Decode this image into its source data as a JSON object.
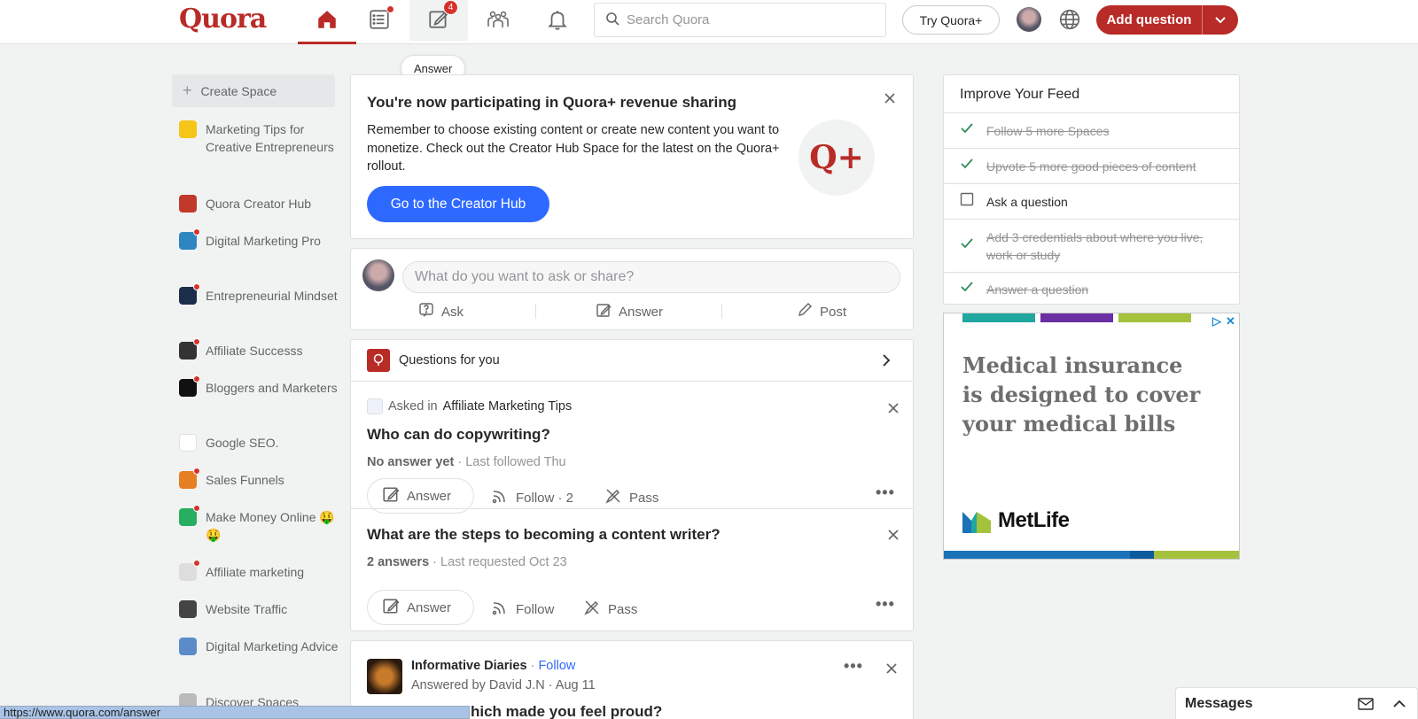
{
  "header": {
    "logo": "Quora",
    "notification_badge": "4",
    "search_placeholder": "Search Quora",
    "try_plus": "Try Quora+",
    "add_question": "Add question"
  },
  "tooltip": "Answer",
  "sidebar": {
    "create_space": "Create Space",
    "items": [
      {
        "label": "Marketing Tips for Creative Entrepreneurs",
        "color": "#f5c518"
      },
      {
        "label": "Quora Creator Hub",
        "color": "#c0392b"
      },
      {
        "label": "Digital Marketing Pro",
        "color": "#2e86c1"
      },
      {
        "label": "Entrepreneurial Mindset",
        "color": "#1c2e4a"
      },
      {
        "label": "Affiliate Successs",
        "color": "#333333"
      },
      {
        "label": "Bloggers and Marketers",
        "color": "#111111"
      },
      {
        "label": "Google SEO.",
        "color": "#ffffff"
      },
      {
        "label": "Sales Funnels",
        "color": "#e67e22"
      },
      {
        "label": "Make Money Online 🤑🤑",
        "color": "#27ae60"
      },
      {
        "label": "Affiliate marketing",
        "color": "#dddddd"
      },
      {
        "label": "Website Traffic",
        "color": "#444444"
      },
      {
        "label": "Digital Marketing Advice",
        "color": "#5b8cc9"
      },
      {
        "label": "Discover Spaces",
        "color": "#bbbbbb"
      }
    ]
  },
  "promo": {
    "title": "You're now participating in Quora+ revenue sharing",
    "body": "Remember to choose existing content or create new content you want to monetize. Check out the Creator Hub Space for the latest on the Quora+ rollout.",
    "cta": "Go to the Creator Hub",
    "badge": "Q+"
  },
  "composer": {
    "placeholder": "What do you want to ask or share?",
    "ask": "Ask",
    "answer": "Answer",
    "post": "Post"
  },
  "questions": {
    "header": "Questions for you",
    "items": [
      {
        "asked_in_prefix": "Asked in",
        "asked_in": "Affiliate Marketing Tips",
        "title": "Who can do copywriting?",
        "status": "No answer yet",
        "meta": " · Last followed Thu",
        "answer": "Answer",
        "follow": "Follow · 2",
        "pass": "Pass"
      },
      {
        "title": "What are the steps to becoming a content writer?",
        "status": "2 answers",
        "meta": " · Last requested Oct 23",
        "answer": "Answer",
        "follow": "Follow",
        "pass": "Pass"
      }
    ]
  },
  "post": {
    "space": "Informative Diaries",
    "follow": "Follow",
    "sep": " · ",
    "byline": "Answered by David J.N · Aug 11",
    "title_partial": "hich made you feel proud?"
  },
  "improve_feed": {
    "title": "Improve Your Feed",
    "items": [
      {
        "label": "Follow 5 more Spaces",
        "done": true
      },
      {
        "label": "Upvote 5 more good pieces of content",
        "done": true
      },
      {
        "label": "Ask a question",
        "done": false
      },
      {
        "label": "Add 3 credentials about where you live, work or study",
        "done": true
      },
      {
        "label": "Answer a question",
        "done": true
      }
    ]
  },
  "ad": {
    "headline_1": "Medical insurance",
    "headline_2": "is designed to cover",
    "headline_3": "your medical bills",
    "brand": "MetLife",
    "stripe_colors": [
      "#20a7a0",
      "#6a2fa2",
      "#a5c23c"
    ],
    "bottom_colors": [
      "#1a72b8",
      "#0d5a9e",
      "#a5c23c"
    ]
  },
  "statusbar_url": "https://www.quora.com/answer",
  "messages": "Messages",
  "colors": {
    "brand": "#b92b27",
    "primary_blue": "#2e69ff",
    "check_green": "#2e8b57"
  }
}
